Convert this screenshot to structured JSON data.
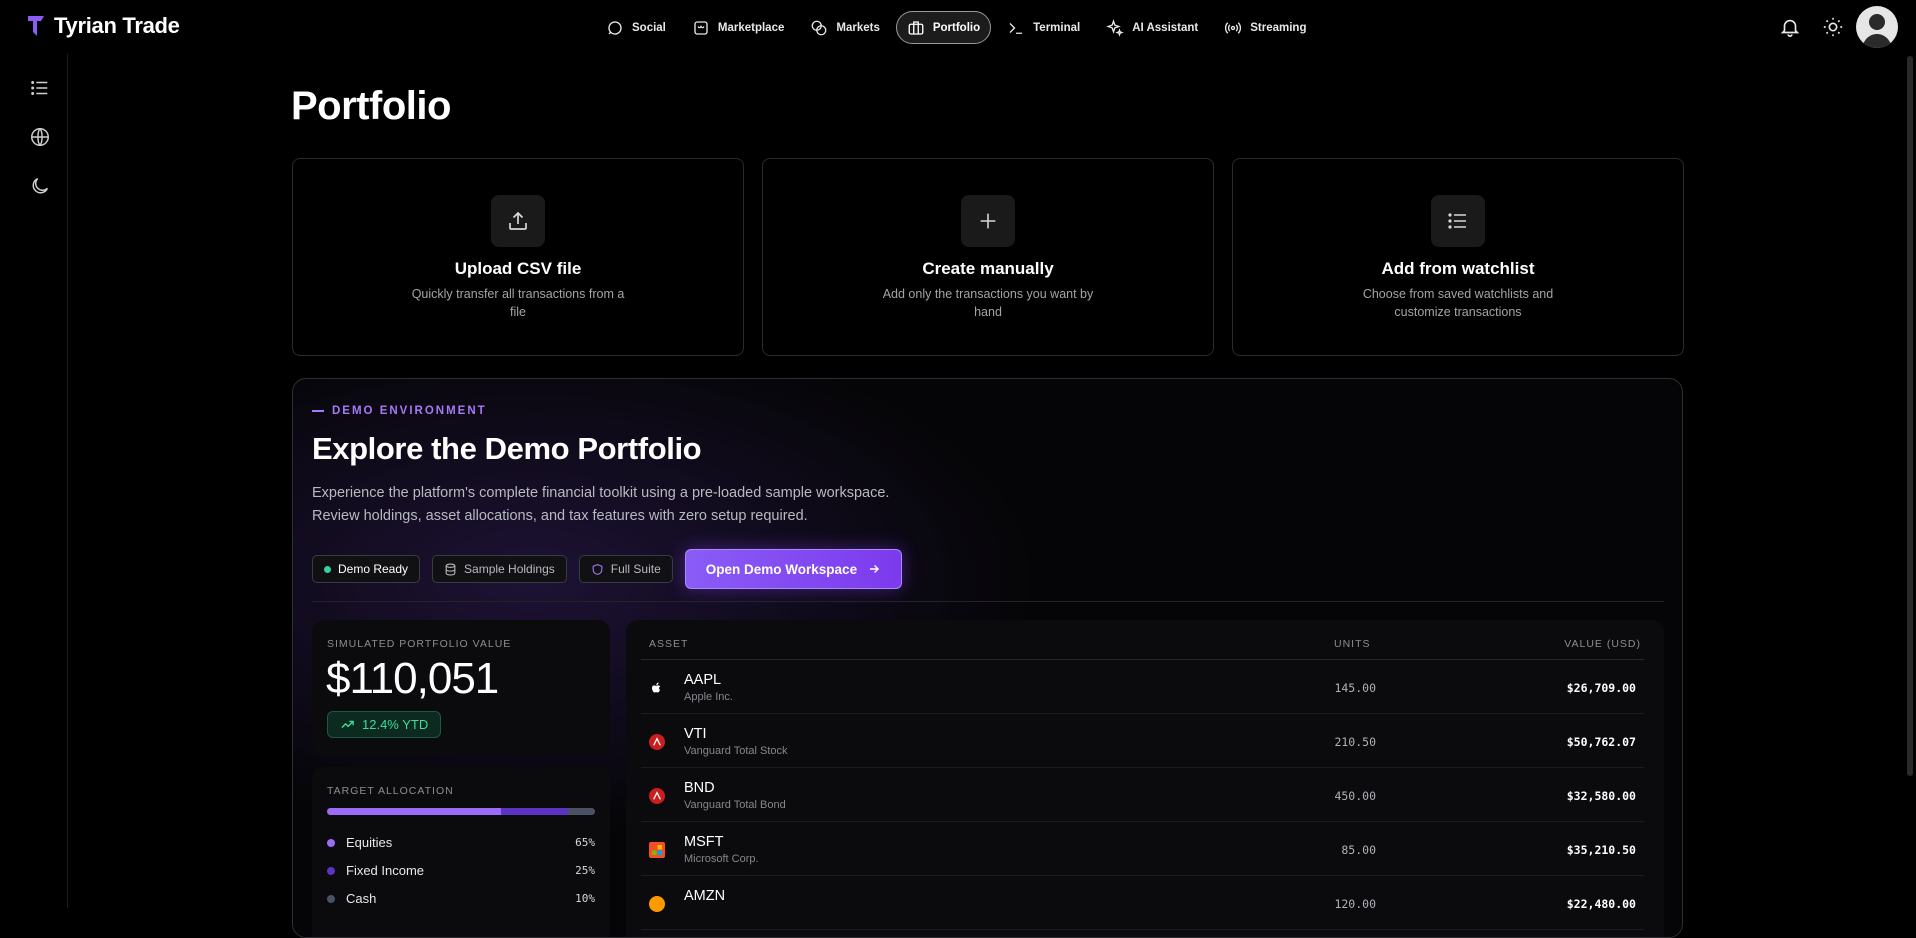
{
  "brand": {
    "name": "Tyrian Trade",
    "accent": "#8b5cf6"
  },
  "nav": {
    "items": [
      {
        "label": "Social",
        "icon": "chat-icon"
      },
      {
        "label": "Marketplace",
        "icon": "store-icon"
      },
      {
        "label": "Markets",
        "icon": "coins-icon"
      },
      {
        "label": "Portfolio",
        "icon": "briefcase-icon",
        "active": true
      },
      {
        "label": "Terminal",
        "icon": "terminal-icon"
      },
      {
        "label": "AI Assistant",
        "icon": "sparkles-icon"
      },
      {
        "label": "Streaming",
        "icon": "broadcast-icon"
      }
    ]
  },
  "sidebar": {
    "icons": [
      "list-icon",
      "globe-icon",
      "moon-icon"
    ]
  },
  "page": {
    "title": "Portfolio"
  },
  "cards": [
    {
      "title": "Upload CSV file",
      "desc": "Quickly transfer all transactions from a file",
      "icon": "upload-icon"
    },
    {
      "title": "Create manually",
      "desc": "Add only the transactions you want by hand",
      "icon": "plus-icon"
    },
    {
      "title": "Add from watchlist",
      "desc": "Choose from saved watchlists and customize transactions",
      "icon": "list-icon"
    }
  ],
  "demo": {
    "eyebrow": "DEMO ENVIRONMENT",
    "title": "Explore the Demo Portfolio",
    "desc_line1": "Experience the platform's complete financial toolkit using a pre-loaded sample workspace.",
    "desc_line2": "Review holdings, asset allocations, and tax features with zero setup required.",
    "chips": {
      "ready": "Demo Ready",
      "holdings": "Sample Holdings",
      "suite": "Full Suite"
    },
    "cta": "Open Demo Workspace",
    "value_label": "SIMULATED PORTFOLIO VALUE",
    "value": "$110,051",
    "ytd": "12.4% YTD",
    "allocation": {
      "label": "TARGET ALLOCATION",
      "items": [
        {
          "name": "Equities",
          "pct": "65%",
          "fraction": 0.65,
          "color": "#9b6cf7"
        },
        {
          "name": "Fixed Income",
          "pct": "25%",
          "fraction": 0.25,
          "color": "#5b34c4"
        },
        {
          "name": "Cash",
          "pct": "10%",
          "fraction": 0.1,
          "color": "#4a5263"
        }
      ]
    },
    "table": {
      "headers": {
        "asset": "ASSET",
        "units": "UNITS",
        "value": "VALUE (USD)"
      },
      "rows": [
        {
          "ticker": "AAPL",
          "name": "Apple Inc.",
          "units": "145.00",
          "value": "$26,709.00",
          "icon": "apple-icon",
          "icon_color": "#ffffff"
        },
        {
          "ticker": "VTI",
          "name": "Vanguard Total Stock",
          "units": "210.50",
          "value": "$50,762.07",
          "icon": "vanguard-icon",
          "icon_color": "#c81e1e"
        },
        {
          "ticker": "BND",
          "name": "Vanguard Total Bond",
          "units": "450.00",
          "value": "$32,580.00",
          "icon": "vanguard-icon",
          "icon_color": "#c81e1e"
        },
        {
          "ticker": "MSFT",
          "name": "Microsoft Corp.",
          "units": "85.00",
          "value": "$35,210.50",
          "icon": "microsoft-icon",
          "icon_color": "#f25022"
        },
        {
          "ticker": "AMZN",
          "name": "",
          "units": "120.00",
          "value": "$22,480.00",
          "icon": "amazon-icon",
          "icon_color": "#ff9900"
        }
      ]
    }
  }
}
